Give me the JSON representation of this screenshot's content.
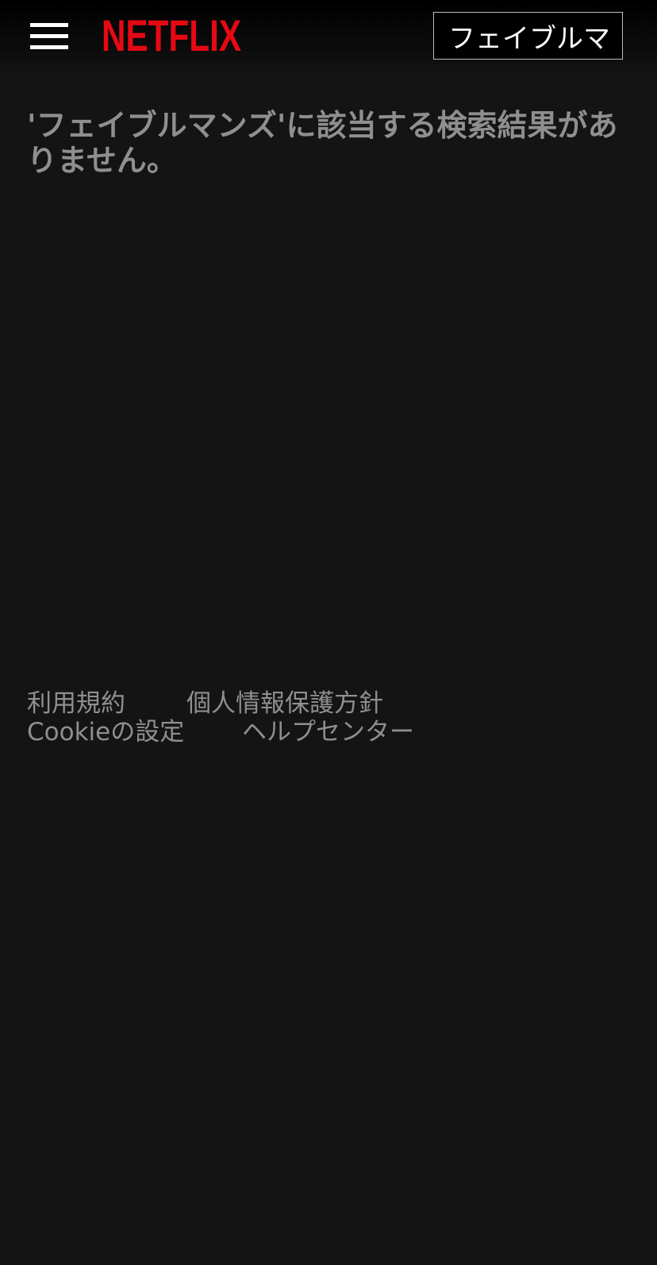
{
  "header": {
    "menu_icon": "hamburger-menu-icon",
    "logo_text": "NETFLIX",
    "brand_color": "#e50914",
    "search_value": "フェイブルマ"
  },
  "main": {
    "no_results_message": "'フェイブルマンズ'に該当する検索結果がありません。"
  },
  "footer": {
    "links": [
      "利用規約",
      "個人情報保護方針",
      "Cookieの設定",
      "ヘルプセンター"
    ]
  }
}
